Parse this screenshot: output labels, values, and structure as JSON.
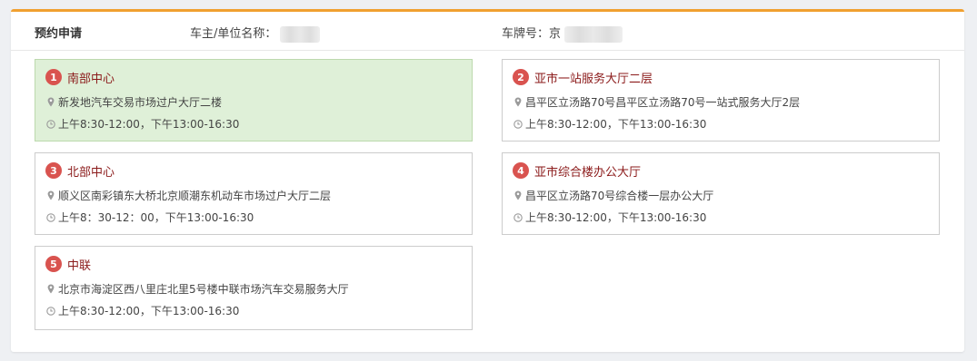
{
  "header": {
    "title": "预约申请",
    "owner_label": "车主/单位名称：",
    "plate_label": "车牌号：京"
  },
  "colors": {
    "accent_top_border": "#f0a030",
    "badge": "#d9534f",
    "selected_bg": "#dff0d8",
    "location_name": "#8b1a1a"
  },
  "locations": [
    {
      "number": "1",
      "name": "南部中心",
      "address": "新发地汽车交易市场过户大厅二楼",
      "hours": "上午8:30-12:00，下午13:00-16:30",
      "selected": true
    },
    {
      "number": "2",
      "name": "亚市一站服务大厅二层",
      "address": "昌平区立汤路70号昌平区立汤路70号一站式服务大厅2层",
      "hours": "上午8:30-12:00，下午13:00-16:30",
      "selected": false
    },
    {
      "number": "3",
      "name": "北部中心",
      "address": "顺义区南彩镇东大桥北京顺潮东机动车市场过户大厅二层",
      "hours": "上午8：30-12：00，下午13:00-16:30",
      "selected": false
    },
    {
      "number": "4",
      "name": "亚市综合楼办公大厅",
      "address": "昌平区立汤路70号综合楼一层办公大厅",
      "hours": "上午8:30-12:00，下午13:00-16:30",
      "selected": false
    },
    {
      "number": "5",
      "name": "中联",
      "address": "北京市海淀区西八里庄北里5号楼中联市场汽车交易服务大厅",
      "hours": "上午8:30-12:00，下午13:00-16:30",
      "selected": false
    }
  ]
}
